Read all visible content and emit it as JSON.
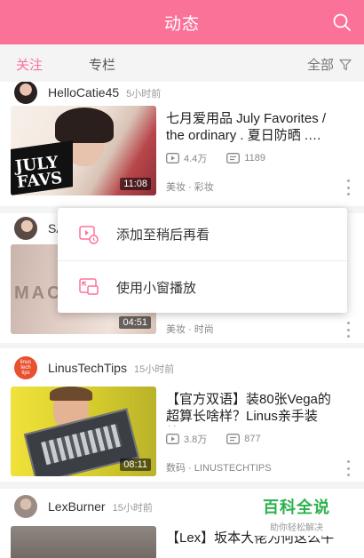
{
  "header": {
    "title": "动态"
  },
  "tabs": {
    "follow": "关注",
    "column": "专栏",
    "all": "全部"
  },
  "feed": [
    {
      "uploader": "HelloCatie45",
      "time": "5小时前",
      "title": "七月爱用品 July Favorites / the ordinary . 夏日防晒 .…",
      "views": "4.4万",
      "danmaku": "1189",
      "duration": "11:08",
      "tags": "美妆 · 彩妆",
      "thumb_text": "JULY FAVS"
    },
    {
      "uploader": "SA",
      "time": "",
      "title": "",
      "views": "",
      "danmaku": "",
      "duration": "04:51",
      "tags": "美妆 · 时尚",
      "thumb_text": "MAC"
    },
    {
      "uploader": "LinusTechTips",
      "time": "15小时前",
      "title": "【官方双语】装80张Vega的超算长啥样？Linus亲手装给…",
      "views": "3.8万",
      "danmaku": "877",
      "duration": "08:11",
      "tags": "数码 · LINUSTECHTIPS",
      "avatar_text": "linus tech tips"
    },
    {
      "uploader": "LexBurner",
      "time": "15小时前",
      "title": "【Lex】坂本大佬为何这么牛",
      "views": "",
      "danmaku": "",
      "duration": "",
      "tags": ""
    }
  ],
  "popup": {
    "watch_later": "添加至稍后再看",
    "mini_player": "使用小窗播放"
  },
  "watermark": {
    "title": "百科全说",
    "subtitle": "助你轻松解决"
  },
  "colors": {
    "accent": "#fb7299",
    "watermark_green": "#2bb24c"
  }
}
